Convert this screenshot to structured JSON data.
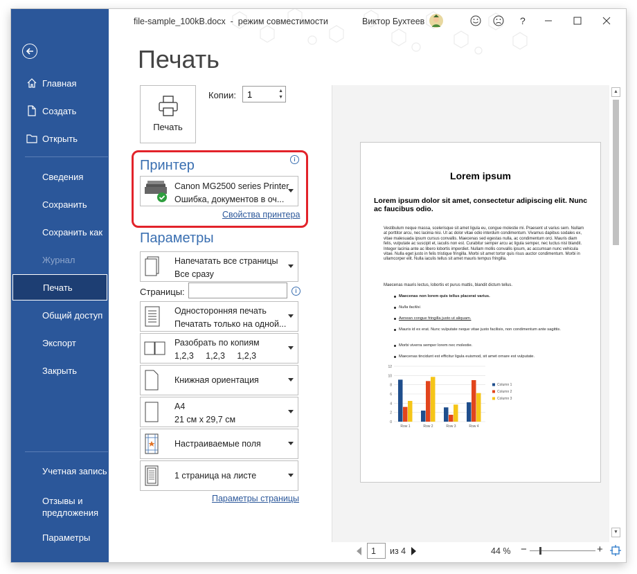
{
  "titlebar": {
    "filename": "file-sample_100kB.docx",
    "separator": "-",
    "mode": "режим совместимости",
    "user": "Виктор Бухтеев",
    "smile_icon": "smile-icon",
    "frown_icon": "frown-icon",
    "help_label": "?"
  },
  "sidebar": {
    "back_icon": "arrow-left-icon",
    "items": [
      {
        "label": "Главная",
        "icon": "home-icon"
      },
      {
        "label": "Создать",
        "icon": "new-document-icon"
      },
      {
        "label": "Открыть",
        "icon": "folder-icon"
      },
      {
        "label": "Сведения"
      },
      {
        "label": "Сохранить"
      },
      {
        "label": "Сохранить как"
      },
      {
        "label": "Журнал"
      },
      {
        "label": "Печать"
      },
      {
        "label": "Общий доступ"
      },
      {
        "label": "Экспорт"
      },
      {
        "label": "Закрыть"
      },
      {
        "label": "Учетная запись"
      },
      {
        "label": "Отзывы и предложения"
      },
      {
        "label": "Параметры"
      }
    ]
  },
  "page_title": "Печать",
  "print_button": {
    "label": "Печать"
  },
  "copies": {
    "label": "Копии:",
    "value": "1"
  },
  "printer": {
    "heading": "Принтер",
    "name": "Canon MG2500 series Printer",
    "status": "Ошибка, документов в оч...",
    "properties_link": "Свойства принтера"
  },
  "settings": {
    "heading": "Параметры",
    "range": {
      "line1": "Напечатать все страницы",
      "line2": "Все сразу"
    },
    "pages_label": "Страницы:",
    "sides": {
      "line1": "Односторонняя печать",
      "line2": "Печатать только на одной..."
    },
    "collate": {
      "line1": "Разобрать по копиям",
      "line2": "1,2,3     1,2,3     1,2,3"
    },
    "orientation": {
      "line1": "Книжная ориентация"
    },
    "paper": {
      "line1": "A4",
      "line2": "21 см x 29,7 см"
    },
    "margins": {
      "line1": "Настраиваемые поля"
    },
    "per_sheet": {
      "line1": "1 страница на листе"
    },
    "page_setup_link": "Параметры страницы"
  },
  "preview": {
    "title": "Lorem ipsum",
    "heading": "Lorem ipsum dolor sit amet, consectetur adipiscing elit. Nunc ac faucibus odio.",
    "para1": "Vestibulum neque massa, scelerisque sit amet ligula eu, congue molestie mi. Praesent ut varius sem. Nullam at porttitor arcu, nec lacinia nisi. Ut ac dolor vitae odio interdum condimentum. Vivamus dapibus sodales ex, vitae malesuada ipsum cursus convallis. Maecenas sed egestas nulla, ac condimentum orci. Mauris diam felis, vulputate ac suscipit et, iaculis non est. Curabitur semper arcu ac ligula semper, nec luctus nisl blandit. Integer lacinia ante ac libero lobortis imperdiet. Nullam mollis convallis ipsum, ac accumsan nunc vehicula vitae. Nulla eget justo in felis tristique fringilla. Morbi sit amet tortor quis risus auctor condimentum. Morbi in ullamcorper elit. Nulla iaculis tellus sit amet mauris tempus fringilla.",
    "para2": "Maecenas mauris lectus, lobortis et purus mattis, blandit dictum tellus.",
    "bullets": [
      "Maecenas non lorem quis tellus placerat varius.",
      "Nulla facilisi.",
      "Aenean congue fringilla justo ut aliquam.",
      "Mauris id ex erat. Nunc vulputate neque vitae justo facilisis, non condimentum ante sagittis.",
      "Morbi viverra semper lorem nec molestie.",
      "Maecenas tincidunt est efficitur ligula euismod, sit amet ornare est vulputate."
    ]
  },
  "chart_data": {
    "type": "bar",
    "categories": [
      "Row 1",
      "Row 2",
      "Row 3",
      "Row 4"
    ],
    "series": [
      {
        "name": "Column 1",
        "values": [
          9.1,
          2.4,
          3.1,
          4.2
        ],
        "color": "#1f4e8c"
      },
      {
        "name": "Column 2",
        "values": [
          3.2,
          8.8,
          1.5,
          9.0
        ],
        "color": "#e2451c"
      },
      {
        "name": "Column 3",
        "values": [
          4.5,
          9.7,
          3.7,
          6.2
        ],
        "color": "#f5c518"
      }
    ],
    "ylim": [
      0,
      12
    ],
    "yticks": [
      "0",
      "2",
      "4",
      "6",
      "8",
      "10",
      "12"
    ],
    "legend": "right"
  },
  "bottom": {
    "page_value": "1",
    "of_text": "из 4",
    "zoom": "44 %",
    "zoom_level": 0.44
  }
}
